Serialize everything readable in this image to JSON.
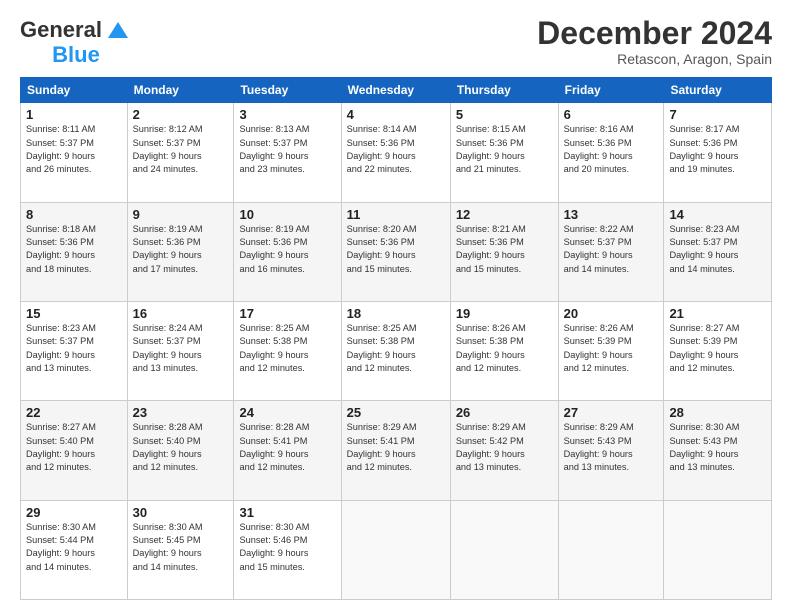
{
  "logo": {
    "text_general": "General",
    "text_blue": "Blue"
  },
  "header": {
    "month": "December 2024",
    "location": "Retascon, Aragon, Spain"
  },
  "days_of_week": [
    "Sunday",
    "Monday",
    "Tuesday",
    "Wednesday",
    "Thursday",
    "Friday",
    "Saturday"
  ],
  "weeks": [
    [
      {
        "day": "1",
        "sunrise": "8:11 AM",
        "sunset": "5:37 PM",
        "daylight": "9 hours and 26 minutes."
      },
      {
        "day": "2",
        "sunrise": "8:12 AM",
        "sunset": "5:37 PM",
        "daylight": "9 hours and 24 minutes."
      },
      {
        "day": "3",
        "sunrise": "8:13 AM",
        "sunset": "5:37 PM",
        "daylight": "9 hours and 23 minutes."
      },
      {
        "day": "4",
        "sunrise": "8:14 AM",
        "sunset": "5:36 PM",
        "daylight": "9 hours and 22 minutes."
      },
      {
        "day": "5",
        "sunrise": "8:15 AM",
        "sunset": "5:36 PM",
        "daylight": "9 hours and 21 minutes."
      },
      {
        "day": "6",
        "sunrise": "8:16 AM",
        "sunset": "5:36 PM",
        "daylight": "9 hours and 20 minutes."
      },
      {
        "day": "7",
        "sunrise": "8:17 AM",
        "sunset": "5:36 PM",
        "daylight": "9 hours and 19 minutes."
      }
    ],
    [
      {
        "day": "8",
        "sunrise": "8:18 AM",
        "sunset": "5:36 PM",
        "daylight": "9 hours and 18 minutes."
      },
      {
        "day": "9",
        "sunrise": "8:19 AM",
        "sunset": "5:36 PM",
        "daylight": "9 hours and 17 minutes."
      },
      {
        "day": "10",
        "sunrise": "8:19 AM",
        "sunset": "5:36 PM",
        "daylight": "9 hours and 16 minutes."
      },
      {
        "day": "11",
        "sunrise": "8:20 AM",
        "sunset": "5:36 PM",
        "daylight": "9 hours and 15 minutes."
      },
      {
        "day": "12",
        "sunrise": "8:21 AM",
        "sunset": "5:36 PM",
        "daylight": "9 hours and 15 minutes."
      },
      {
        "day": "13",
        "sunrise": "8:22 AM",
        "sunset": "5:37 PM",
        "daylight": "9 hours and 14 minutes."
      },
      {
        "day": "14",
        "sunrise": "8:23 AM",
        "sunset": "5:37 PM",
        "daylight": "9 hours and 14 minutes."
      }
    ],
    [
      {
        "day": "15",
        "sunrise": "8:23 AM",
        "sunset": "5:37 PM",
        "daylight": "9 hours and 13 minutes."
      },
      {
        "day": "16",
        "sunrise": "8:24 AM",
        "sunset": "5:37 PM",
        "daylight": "9 hours and 13 minutes."
      },
      {
        "day": "17",
        "sunrise": "8:25 AM",
        "sunset": "5:38 PM",
        "daylight": "9 hours and 12 minutes."
      },
      {
        "day": "18",
        "sunrise": "8:25 AM",
        "sunset": "5:38 PM",
        "daylight": "9 hours and 12 minutes."
      },
      {
        "day": "19",
        "sunrise": "8:26 AM",
        "sunset": "5:38 PM",
        "daylight": "9 hours and 12 minutes."
      },
      {
        "day": "20",
        "sunrise": "8:26 AM",
        "sunset": "5:39 PM",
        "daylight": "9 hours and 12 minutes."
      },
      {
        "day": "21",
        "sunrise": "8:27 AM",
        "sunset": "5:39 PM",
        "daylight": "9 hours and 12 minutes."
      }
    ],
    [
      {
        "day": "22",
        "sunrise": "8:27 AM",
        "sunset": "5:40 PM",
        "daylight": "9 hours and 12 minutes."
      },
      {
        "day": "23",
        "sunrise": "8:28 AM",
        "sunset": "5:40 PM",
        "daylight": "9 hours and 12 minutes."
      },
      {
        "day": "24",
        "sunrise": "8:28 AM",
        "sunset": "5:41 PM",
        "daylight": "9 hours and 12 minutes."
      },
      {
        "day": "25",
        "sunrise": "8:29 AM",
        "sunset": "5:41 PM",
        "daylight": "9 hours and 12 minutes."
      },
      {
        "day": "26",
        "sunrise": "8:29 AM",
        "sunset": "5:42 PM",
        "daylight": "9 hours and 13 minutes."
      },
      {
        "day": "27",
        "sunrise": "8:29 AM",
        "sunset": "5:43 PM",
        "daylight": "9 hours and 13 minutes."
      },
      {
        "day": "28",
        "sunrise": "8:30 AM",
        "sunset": "5:43 PM",
        "daylight": "9 hours and 13 minutes."
      }
    ],
    [
      {
        "day": "29",
        "sunrise": "8:30 AM",
        "sunset": "5:44 PM",
        "daylight": "9 hours and 14 minutes."
      },
      {
        "day": "30",
        "sunrise": "8:30 AM",
        "sunset": "5:45 PM",
        "daylight": "9 hours and 14 minutes."
      },
      {
        "day": "31",
        "sunrise": "8:30 AM",
        "sunset": "5:46 PM",
        "daylight": "9 hours and 15 minutes."
      },
      null,
      null,
      null,
      null
    ]
  ],
  "labels": {
    "sunrise": "Sunrise:",
    "sunset": "Sunset:",
    "daylight": "Daylight:"
  }
}
